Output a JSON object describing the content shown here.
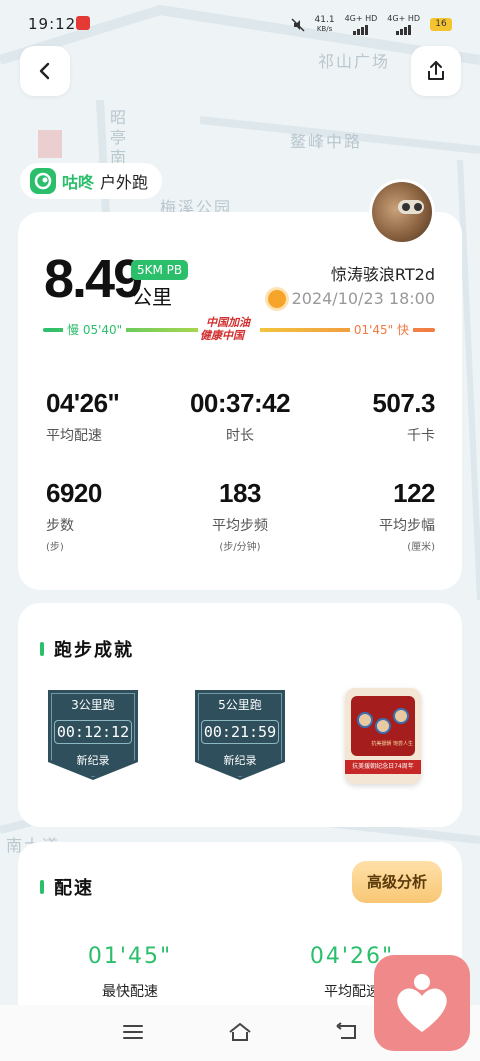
{
  "status_bar": {
    "time": "19:12",
    "net_speed": "41.1",
    "net_unit": "KB/s",
    "sim1": "4G+ HD",
    "sim2": "4G+ HD",
    "battery": "16"
  },
  "map_labels": [
    "祁山广场",
    "昭亭南",
    "鳌峰中路",
    "梅溪公园",
    "南大道"
  ],
  "brand": {
    "name": "咕咚",
    "sub": "户外跑",
    "color": "#2bbf6c"
  },
  "summary": {
    "distance": "8.49",
    "pb_badge": "5KM PB",
    "unit": "公里",
    "user_name": "惊涛骇浪RT2d",
    "datetime": "2024/10/23 18:00",
    "pace_slow_label": "慢 05'40\"",
    "pace_fast_label": "01'45\" 快",
    "logo_line1": "中国加油",
    "logo_line2": "健康中国"
  },
  "stats": [
    {
      "value": "04'26\"",
      "label": "平均配速",
      "sub": ""
    },
    {
      "value": "00:37:42",
      "label": "时长",
      "sub": ""
    },
    {
      "value": "507.3",
      "label": "千卡",
      "sub": ""
    },
    {
      "value": "6920",
      "label": "步数",
      "sub": "(步)"
    },
    {
      "value": "183",
      "label": "平均步频",
      "sub": "(步/分钟)"
    },
    {
      "value": "122",
      "label": "平均步幅",
      "sub": "(厘米)"
    }
  ],
  "achievements": {
    "title": "跑步成就",
    "badges": [
      {
        "title": "3公里跑",
        "time": "00:12:12",
        "sub": "新纪录"
      },
      {
        "title": "5公里跑",
        "time": "00:21:59",
        "sub": "新纪录"
      }
    ],
    "medal_ribbon": "抗美援朝纪念日74周年",
    "medal_caption": "抗美援朝 饱尝人生"
  },
  "pace_section": {
    "title": "配速",
    "advanced_button": "高级分析",
    "fastest_value": "01'45\"",
    "fastest_label": "最快配速",
    "average_value": "04'26\"",
    "average_label": "平均配速"
  },
  "colors": {
    "accent": "#2bbf6c",
    "fast": "#f07a44",
    "badge": "#2f4f5c",
    "heart_bg": "#f08a8a"
  }
}
